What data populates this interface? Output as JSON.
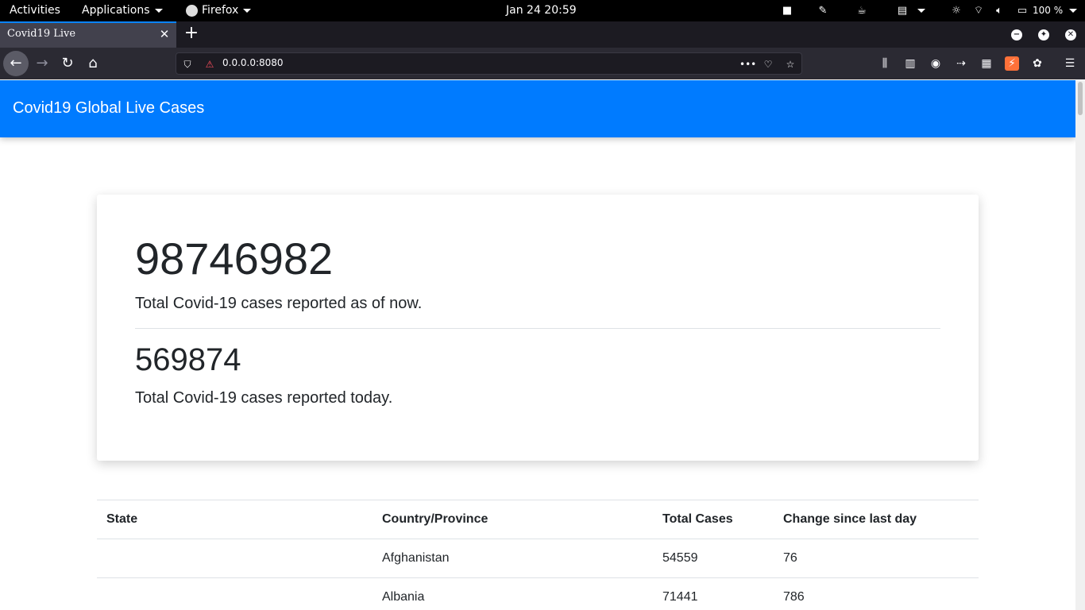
{
  "system_bar": {
    "activities": "Activities",
    "applications": "Applications",
    "firefox": "Firefox",
    "clock": "Jan 24  20:59",
    "battery": "100 %",
    "tray_icons": [
      "camera-icon",
      "pen-icon",
      "coffee-icon",
      "clipboard-icon",
      "brightness-icon",
      "wifi-icon",
      "volume-icon",
      "battery-icon"
    ]
  },
  "browser": {
    "tab_title": "Covid19  Live",
    "url": "0.0.0.0:8080"
  },
  "app": {
    "title": "Covid19 Global Live Cases",
    "total_cases": "98746982",
    "total_caption": "Total Covid-19 cases reported as of now.",
    "today_cases": "569874",
    "today_caption": "Total Covid-19 cases reported today."
  },
  "table": {
    "headers": [
      "State",
      "Country/Province",
      "Total Cases",
      "Change since last day"
    ],
    "rows": [
      [
        "",
        "Afghanistan",
        "54559",
        "76"
      ],
      [
        "",
        "Albania",
        "71441",
        "786"
      ]
    ]
  },
  "colors": {
    "header_blue": "#007bff",
    "system_bar": "#000000",
    "browser_chrome": "#2b2a33"
  }
}
